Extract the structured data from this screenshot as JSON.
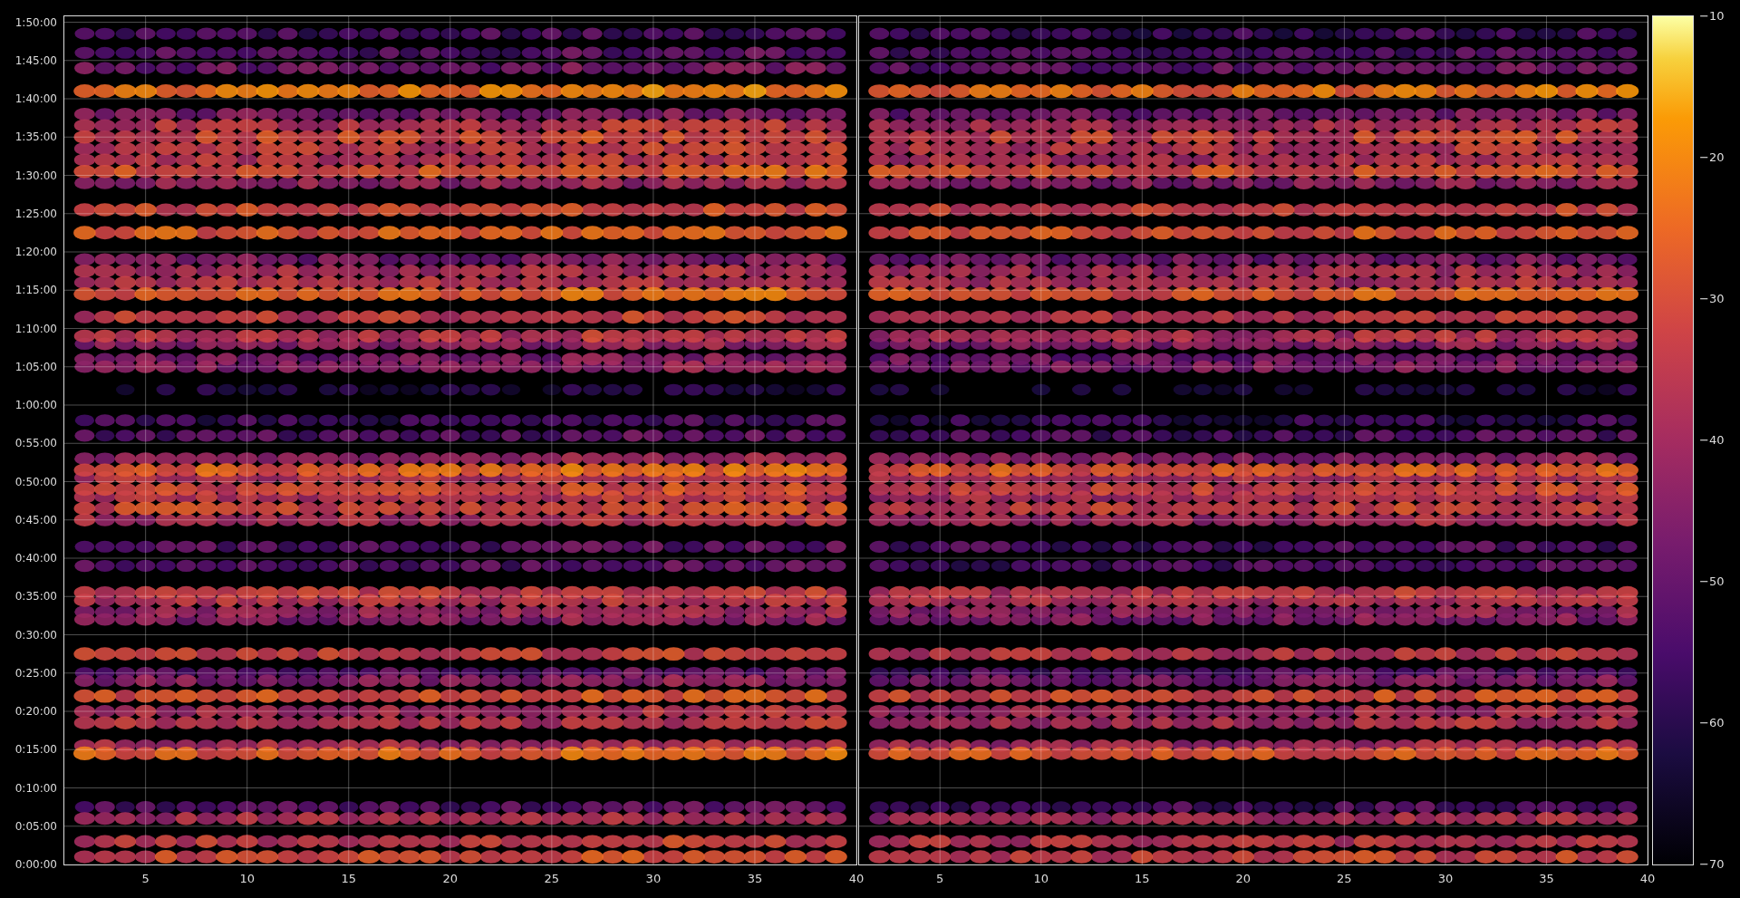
{
  "y_ticks": [
    "1:50:00",
    "1:45:00",
    "1:40:00",
    "1:35:00",
    "1:30:00",
    "1:25:00",
    "1:20:00",
    "1:15:00",
    "1:10:00",
    "1:05:00",
    "1:00:00",
    "0:55:00",
    "0:50:00",
    "0:45:00",
    "0:40:00",
    "0:35:00",
    "0:30:00",
    "0:25:00",
    "0:20:00",
    "0:15:00",
    "0:10:00",
    "0:05:00",
    "0:00:00"
  ],
  "panels": [
    {
      "x_ticks": [
        "5",
        "10",
        "15",
        "20",
        "25",
        "30",
        "35",
        "40"
      ]
    },
    {
      "x_ticks": [
        "5",
        "10",
        "15",
        "20",
        "25",
        "30",
        "35",
        "40"
      ]
    }
  ],
  "colorbar": {
    "ticks": [
      "−10",
      "−20",
      "−30",
      "−40",
      "−50",
      "−60",
      "−70"
    ]
  }
}
